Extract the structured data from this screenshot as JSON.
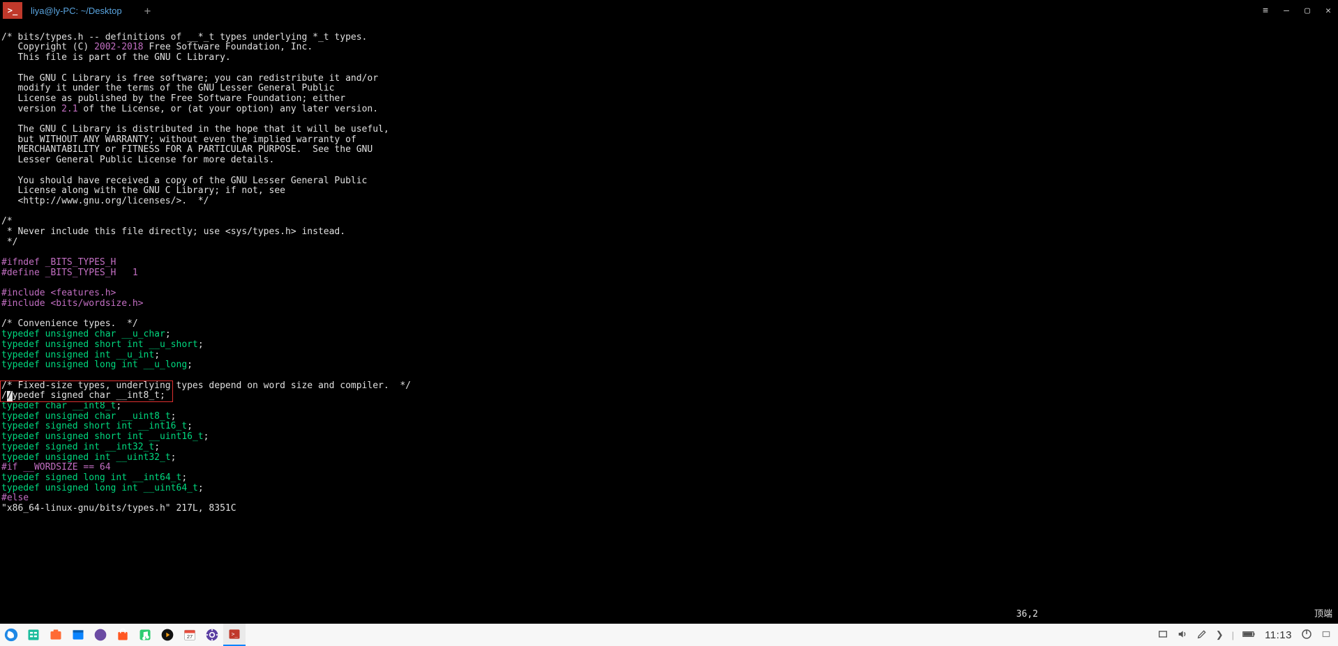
{
  "window": {
    "tab_title": "liya@ly-PC: ~/Desktop",
    "app_icon_char": ">_"
  },
  "editor": {
    "comment_block": "/* bits/types.h -- definitions of __*_t types underlying *_t types.",
    "copyright_prefix": "   Copyright (C) ",
    "copyright_years": "2002-2018",
    "copyright_suffix": " Free Software Foundation, Inc.",
    "lib_line": "   This file is part of the GNU C Library.",
    "blank": "",
    "free1": "   The GNU C Library is free software; you can redistribute it and/or",
    "free2": "   modify it under the terms of the GNU Lesser General Public",
    "free3": "   License as published by the Free Software Foundation; either",
    "ver_prefix": "   version ",
    "ver_num": "2.1",
    "ver_suffix": " of the License, or (at your option) any later version.",
    "dist1": "   The GNU C Library is distributed in the hope that it will be useful,",
    "dist2": "   but WITHOUT ANY WARRANTY; without even the implied warranty of",
    "dist3": "   MERCHANTABILITY or FITNESS FOR A PARTICULAR PURPOSE.  See the GNU",
    "dist4": "   Lesser General Public License for more details.",
    "recv1": "   You should have received a copy of the GNU Lesser General Public",
    "recv2": "   License along with the GNU C Library; if not, see",
    "recv3": "   <http://www.gnu.org/licenses/>.  */",
    "never1": "/*",
    "never2": " * Never include this file directly; use <sys/types.h> instead.",
    "never3": " */",
    "ifndef_kw": "#ifndef",
    "ifndef_id": "\t_BITS_TYPES_H",
    "define_kw": "#define",
    "define_id": " _BITS_TYPES_H\t",
    "define_val": "1",
    "include_kw": "#include ",
    "include_features": "<features.h>",
    "include_wordsize": "<bits/wordsize.h>",
    "conv_comment": "/* Convenience types.  */",
    "typedef_kw": "typedef",
    "unsigned_kw": " unsigned ",
    "signed_kw": " signed ",
    "char_kw": "char ",
    "short_int_kw": "short int ",
    "int_kw": "int ",
    "long_int_kw": "long int ",
    "u_char": "__u_char",
    "u_short": "__u_short",
    "u_int": "__u_int",
    "u_long": "__u_long",
    "semi": ";",
    "fixed_comment": "/* Fixed-size types, underlying types depend on word size and compiler.  */",
    "box_line1_prefix": "//",
    "box_line1_rest": "typedef signed char __int8_t;",
    "box_line2_a": "typedef",
    "box_line2_b": " char ",
    "box_line2_c": "__int8_t",
    "uint8": "__uint8_t",
    "int16": "__int16_t",
    "uint16": "__uint16_t",
    "int32": "__int32_t",
    "uint32": "__uint32_t",
    "if_wordsize": "#if __WORDSIZE == 64",
    "int64": "__int64_t",
    "uint64": "__uint64_t",
    "else": "#else",
    "file_status": "\"x86_64-linux-gnu/bits/types.h\" 217L, 8351C"
  },
  "vim_status": {
    "pos": "36,2",
    "scroll": "顶端"
  },
  "taskbar": {
    "clock": "11:13",
    "calendar_day": "27"
  }
}
